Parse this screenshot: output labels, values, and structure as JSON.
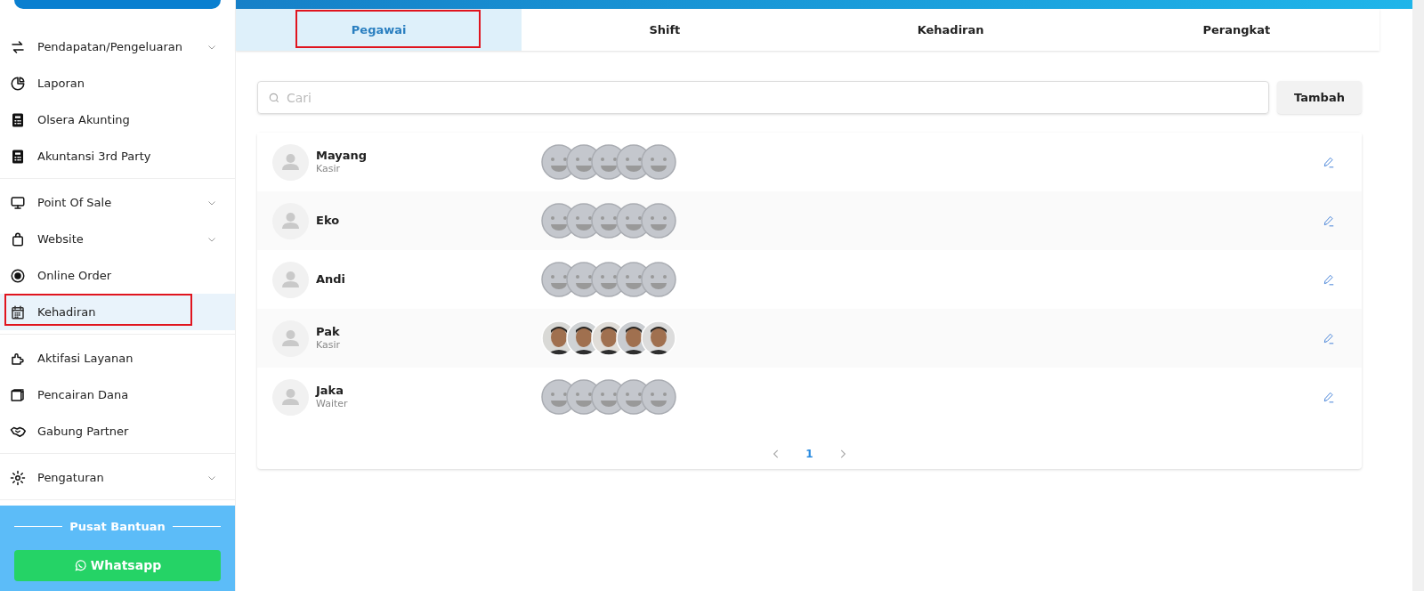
{
  "sidebar": {
    "groups": [
      {
        "items": [
          {
            "label": "Pendapatan/Pengeluaran",
            "expandable": true,
            "selected": false,
            "highlighted": false
          },
          {
            "label": "Laporan",
            "expandable": false,
            "selected": false,
            "highlighted": false
          },
          {
            "label": "Olsera Akunting",
            "expandable": false,
            "selected": false,
            "highlighted": false
          },
          {
            "label": "Akuntansi 3rd Party",
            "expandable": false,
            "selected": false,
            "highlighted": false
          }
        ]
      },
      {
        "items": [
          {
            "label": "Point Of Sale",
            "expandable": true,
            "selected": false,
            "highlighted": false
          },
          {
            "label": "Website",
            "expandable": true,
            "selected": false,
            "highlighted": false
          },
          {
            "label": "Online Order",
            "expandable": false,
            "selected": false,
            "highlighted": false
          },
          {
            "label": "Kehadiran",
            "expandable": false,
            "selected": true,
            "highlighted": true
          }
        ]
      },
      {
        "items": [
          {
            "label": "Aktifasi Layanan",
            "expandable": false,
            "selected": false,
            "highlighted": false
          },
          {
            "label": "Pencairan Dana",
            "expandable": false,
            "selected": false,
            "highlighted": false
          },
          {
            "label": "Gabung Partner",
            "expandable": false,
            "selected": false,
            "highlighted": false
          }
        ]
      },
      {
        "items": [
          {
            "label": "Pengaturan",
            "expandable": true,
            "selected": false,
            "highlighted": false
          }
        ]
      }
    ],
    "help": {
      "title": "Pusat Bantuan",
      "whatsapp": "Whatsapp"
    }
  },
  "tabs": [
    {
      "label": "Pegawai",
      "selected": true,
      "highlighted": true
    },
    {
      "label": "Shift",
      "selected": false,
      "highlighted": false
    },
    {
      "label": "Kehadiran",
      "selected": false,
      "highlighted": false
    },
    {
      "label": "Perangkat",
      "selected": false,
      "highlighted": false
    }
  ],
  "search": {
    "placeholder": "Cari"
  },
  "add_button": "Tambah",
  "employees": [
    {
      "name": "Mayang",
      "role": "Kasir",
      "kind": "placeholder"
    },
    {
      "name": "Eko",
      "kind": "placeholder"
    },
    {
      "name": "Andi",
      "kind": "placeholder"
    },
    {
      "name": "Pak",
      "role": "Kasir"
    },
    {
      "name": "Jaka",
      "role": "Waiter",
      "kind": "placeholder"
    }
  ],
  "pagination": {
    "pages": [
      {
        "label": "1",
        "selected": true
      }
    ]
  }
}
